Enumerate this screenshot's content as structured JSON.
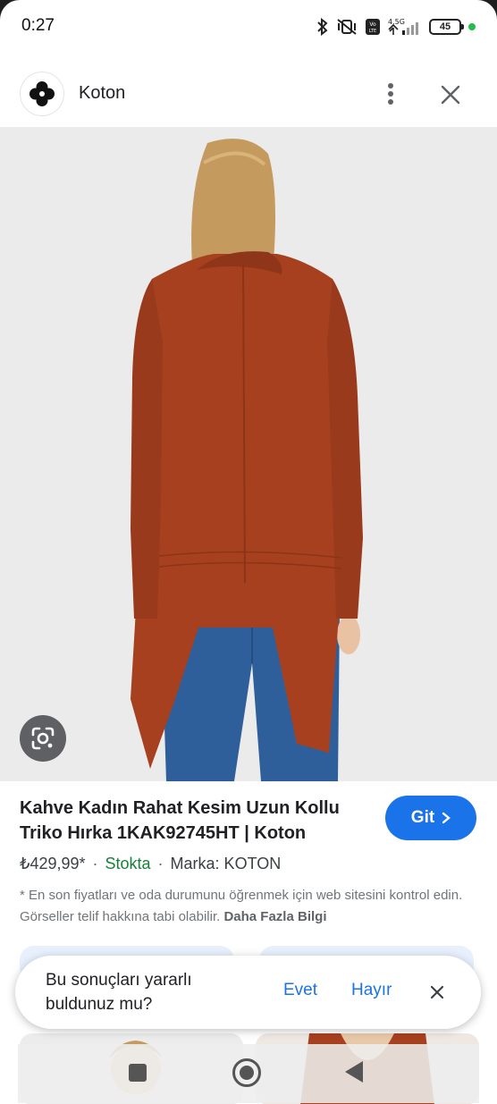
{
  "status_bar": {
    "time": "0:27",
    "network": "4.5G",
    "volte": "Vo LTE",
    "battery": "45"
  },
  "header": {
    "site_name": "Koton",
    "icons": {
      "logo": "koton-logo",
      "menu": "more-vert-icon",
      "close": "close-icon"
    }
  },
  "product": {
    "title": "Kahve Kadın Rahat Kesim Uzun Kollu Triko Hırka 1KAK92745HT | Koton",
    "visit_label": "Git",
    "price": "₺429,99*",
    "separator": "·",
    "stock": "Stokta",
    "brand": "Marka: KOTON",
    "disclaimer": "* En son fiyatları ve oda durumunu öğrenmek için web sitesini kontrol edin. Görseller telif hakkına tabi olabilir.",
    "more_info": "Daha Fazla Bilgi"
  },
  "feedback": {
    "question": "Bu sonuçları yararlı buldunuz mu?",
    "yes": "Evet",
    "no": "Hayır"
  },
  "colors": {
    "accent": "#1a73e8",
    "stock_green": "#188038",
    "cardigan": "#a7401f",
    "jeans": "#2f5f9a"
  }
}
